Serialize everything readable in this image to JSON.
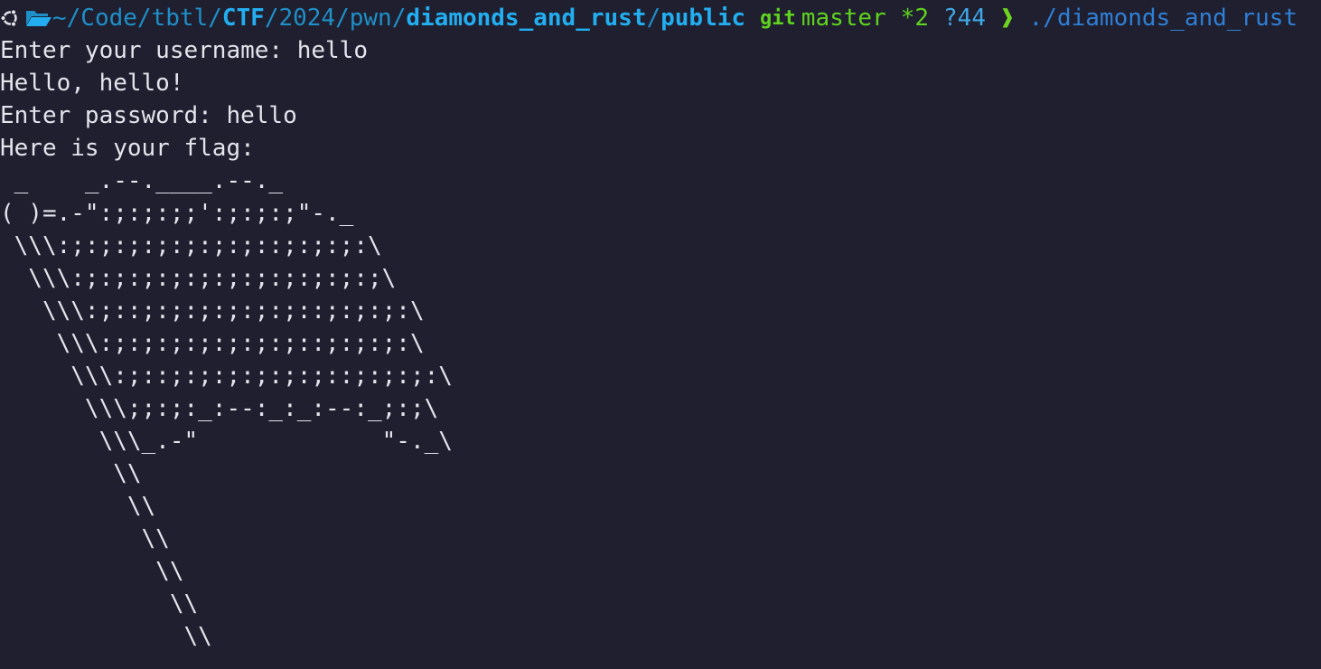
{
  "prompt": {
    "icon_os": "ubuntu-icon",
    "icon_folder": "folder-open-icon",
    "path_prefix": "~/Code/tbtl/",
    "path_bold_1": "CTF",
    "path_mid": "/2024/pwn/",
    "path_bold_2": "diamonds_and_rust",
    "path_sep": "/",
    "path_bold_3": "public",
    "git_label": "git",
    "branch": "master",
    "status_modified": "*2",
    "status_untracked": "?44",
    "arrow": "❱",
    "command": "./diamonds_and_rust"
  },
  "output": {
    "line1": "Enter your username: hello",
    "line2": "Hello, hello!",
    "line3": "Enter password: hello",
    "line4": "Here is your flag:",
    "flag_art": " _    _.--.____.--._\n( )=.-\":;:;:;;':;:;:;\"-._\n \\\\\\:;:;:;:;:;:;:;::;:;:;:\\\n  \\\\\\:;:;:;:;:;:;:;:;:;:;:;\\\n   \\\\\\:;::;:;:;:;:;:;::;:;:;:\\\n    \\\\\\:;:;:;:;:;:;:;::;:;:;:\\\n     \\\\\\:;::;:;:;:;:;:;::;:;:;:\\\n      \\\\\\;;:;:_:--:_:_:--:_;:;\\\n       \\\\\\_.-\"             \"-._\\\n        \\\\\n         \\\\\n          \\\\\n           \\\\\n            \\\\\n             \\\\"
  },
  "colors": {
    "background": "#1f1f2f",
    "foreground": "#e4e4ec",
    "path": "#1f8fc8",
    "git": "#5fd31f",
    "command": "#2f7fd6"
  }
}
